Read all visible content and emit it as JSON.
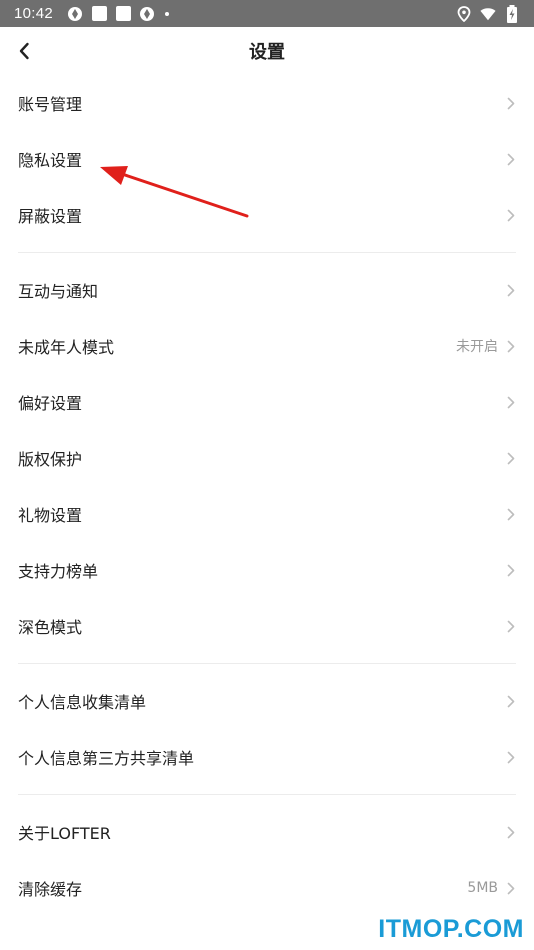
{
  "status_bar": {
    "time": "10:42"
  },
  "header": {
    "title": "设置"
  },
  "groups": [
    {
      "items": [
        {
          "label": "账号管理",
          "value": ""
        },
        {
          "label": "隐私设置",
          "value": ""
        },
        {
          "label": "屏蔽设置",
          "value": ""
        }
      ]
    },
    {
      "items": [
        {
          "label": "互动与通知",
          "value": ""
        },
        {
          "label": "未成年人模式",
          "value": "未开启"
        },
        {
          "label": "偏好设置",
          "value": ""
        },
        {
          "label": "版权保护",
          "value": ""
        },
        {
          "label": "礼物设置",
          "value": ""
        },
        {
          "label": "支持力榜单",
          "value": ""
        },
        {
          "label": "深色模式",
          "value": ""
        }
      ]
    },
    {
      "items": [
        {
          "label": "个人信息收集清单",
          "value": ""
        },
        {
          "label": "个人信息第三方共享清单",
          "value": ""
        }
      ]
    },
    {
      "items": [
        {
          "label": "关于LOFTER",
          "value": ""
        },
        {
          "label": "清除缓存",
          "value": "5MB"
        }
      ]
    }
  ],
  "annotation": {
    "color": "#e0201b"
  },
  "watermark": {
    "text": "ITMOP.COM",
    "color": "#1a9bd6"
  },
  "icons": {
    "back": "chevron-left-icon",
    "row": "chevron-right-icon"
  }
}
